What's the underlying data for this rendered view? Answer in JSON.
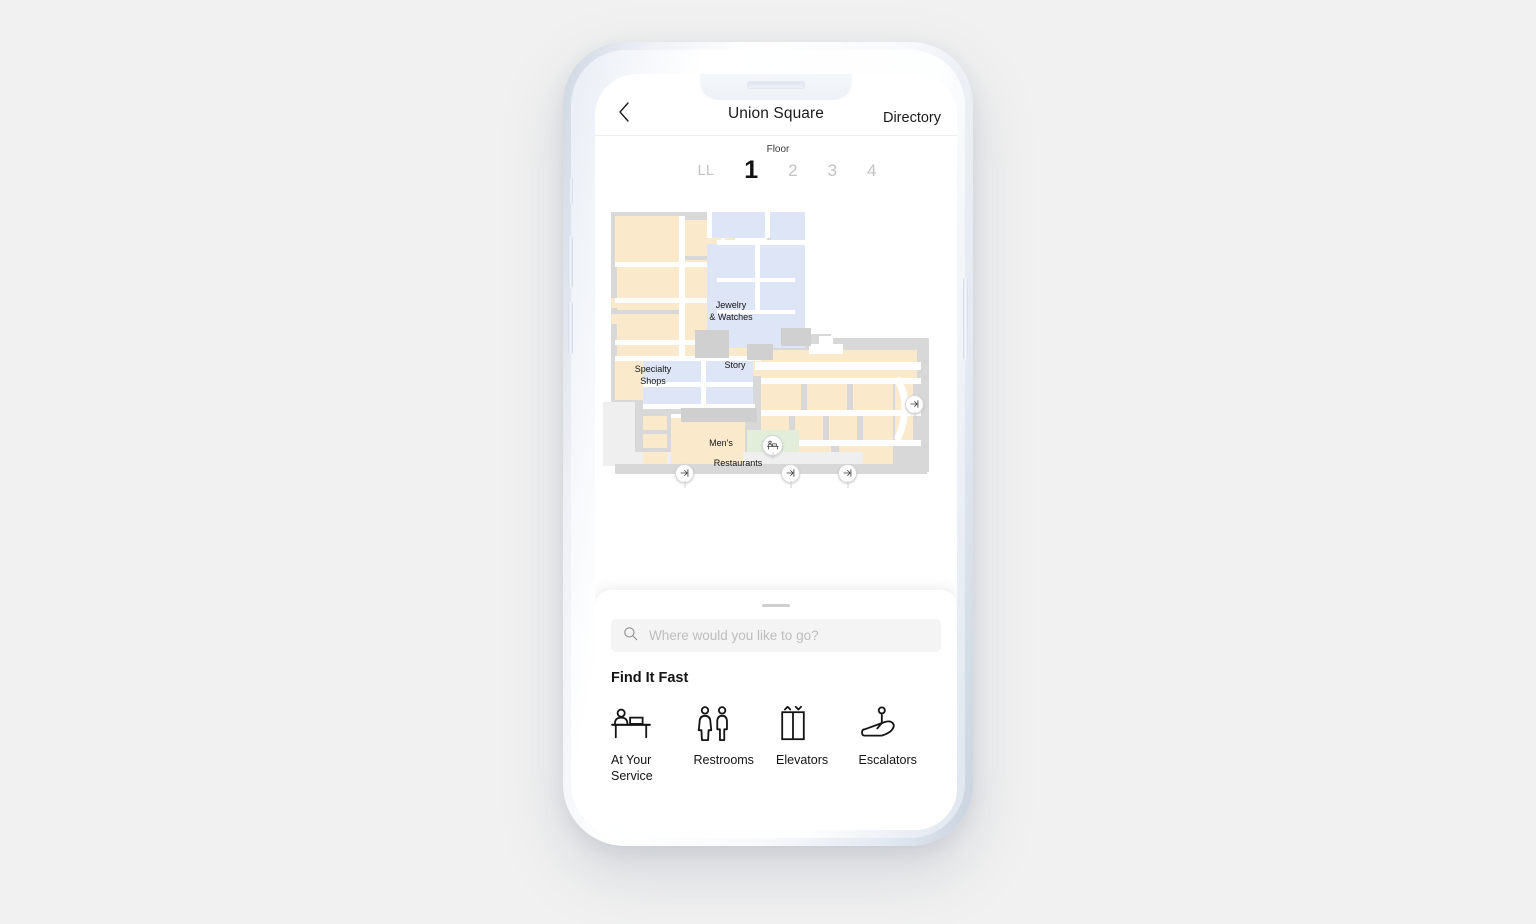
{
  "navbar": {
    "back_icon": "chevron-left-icon",
    "title": "Union Square",
    "action": "Directory"
  },
  "floor_selector": {
    "caption": "Floor",
    "floors": [
      {
        "label": "LL",
        "active": false
      },
      {
        "label": "1",
        "active": true
      },
      {
        "label": "2",
        "active": false
      },
      {
        "label": "3",
        "active": false
      },
      {
        "label": "4",
        "active": false
      }
    ]
  },
  "map": {
    "colors": {
      "retail_cream": "#fbe9cb",
      "retail_blue": "#dde5f6",
      "retail_green": "#e2edda",
      "corridor_gray": "#d8d8d8",
      "walkway_white": "#ffffff",
      "neutral_light": "#efefef",
      "background": "#ffffff"
    },
    "labels": [
      {
        "name": "jewelry-watches",
        "line1": "Jewelry",
        "line2": "& Watches"
      },
      {
        "name": "specialty-shops",
        "line1": "Specialty",
        "line2": "Shops"
      },
      {
        "name": "story",
        "line1": "Story",
        "line2": ""
      },
      {
        "name": "mens",
        "line1": "Men's",
        "line2": ""
      },
      {
        "name": "restaurants",
        "line1": "Restaurants",
        "line2": ""
      }
    ],
    "pins": [
      {
        "name": "exit-pin-east",
        "icon": "exit-icon"
      },
      {
        "name": "exit-pin-southwest",
        "icon": "exit-icon"
      },
      {
        "name": "exit-pin-south-center",
        "icon": "exit-icon"
      },
      {
        "name": "exit-pin-south-east",
        "icon": "exit-icon"
      },
      {
        "name": "service-desk-pin",
        "icon": "service-desk-icon"
      }
    ]
  },
  "sheet": {
    "search": {
      "icon": "search-icon",
      "placeholder": "Where would you like to go?",
      "value": ""
    },
    "title": "Find It Fast",
    "quick_links": [
      {
        "icon": "service-desk-icon",
        "label": "At Your Service"
      },
      {
        "icon": "restrooms-icon",
        "label": "Restrooms"
      },
      {
        "icon": "elevator-icon",
        "label": "Elevators"
      },
      {
        "icon": "escalator-icon",
        "label": "Escalators"
      }
    ]
  }
}
